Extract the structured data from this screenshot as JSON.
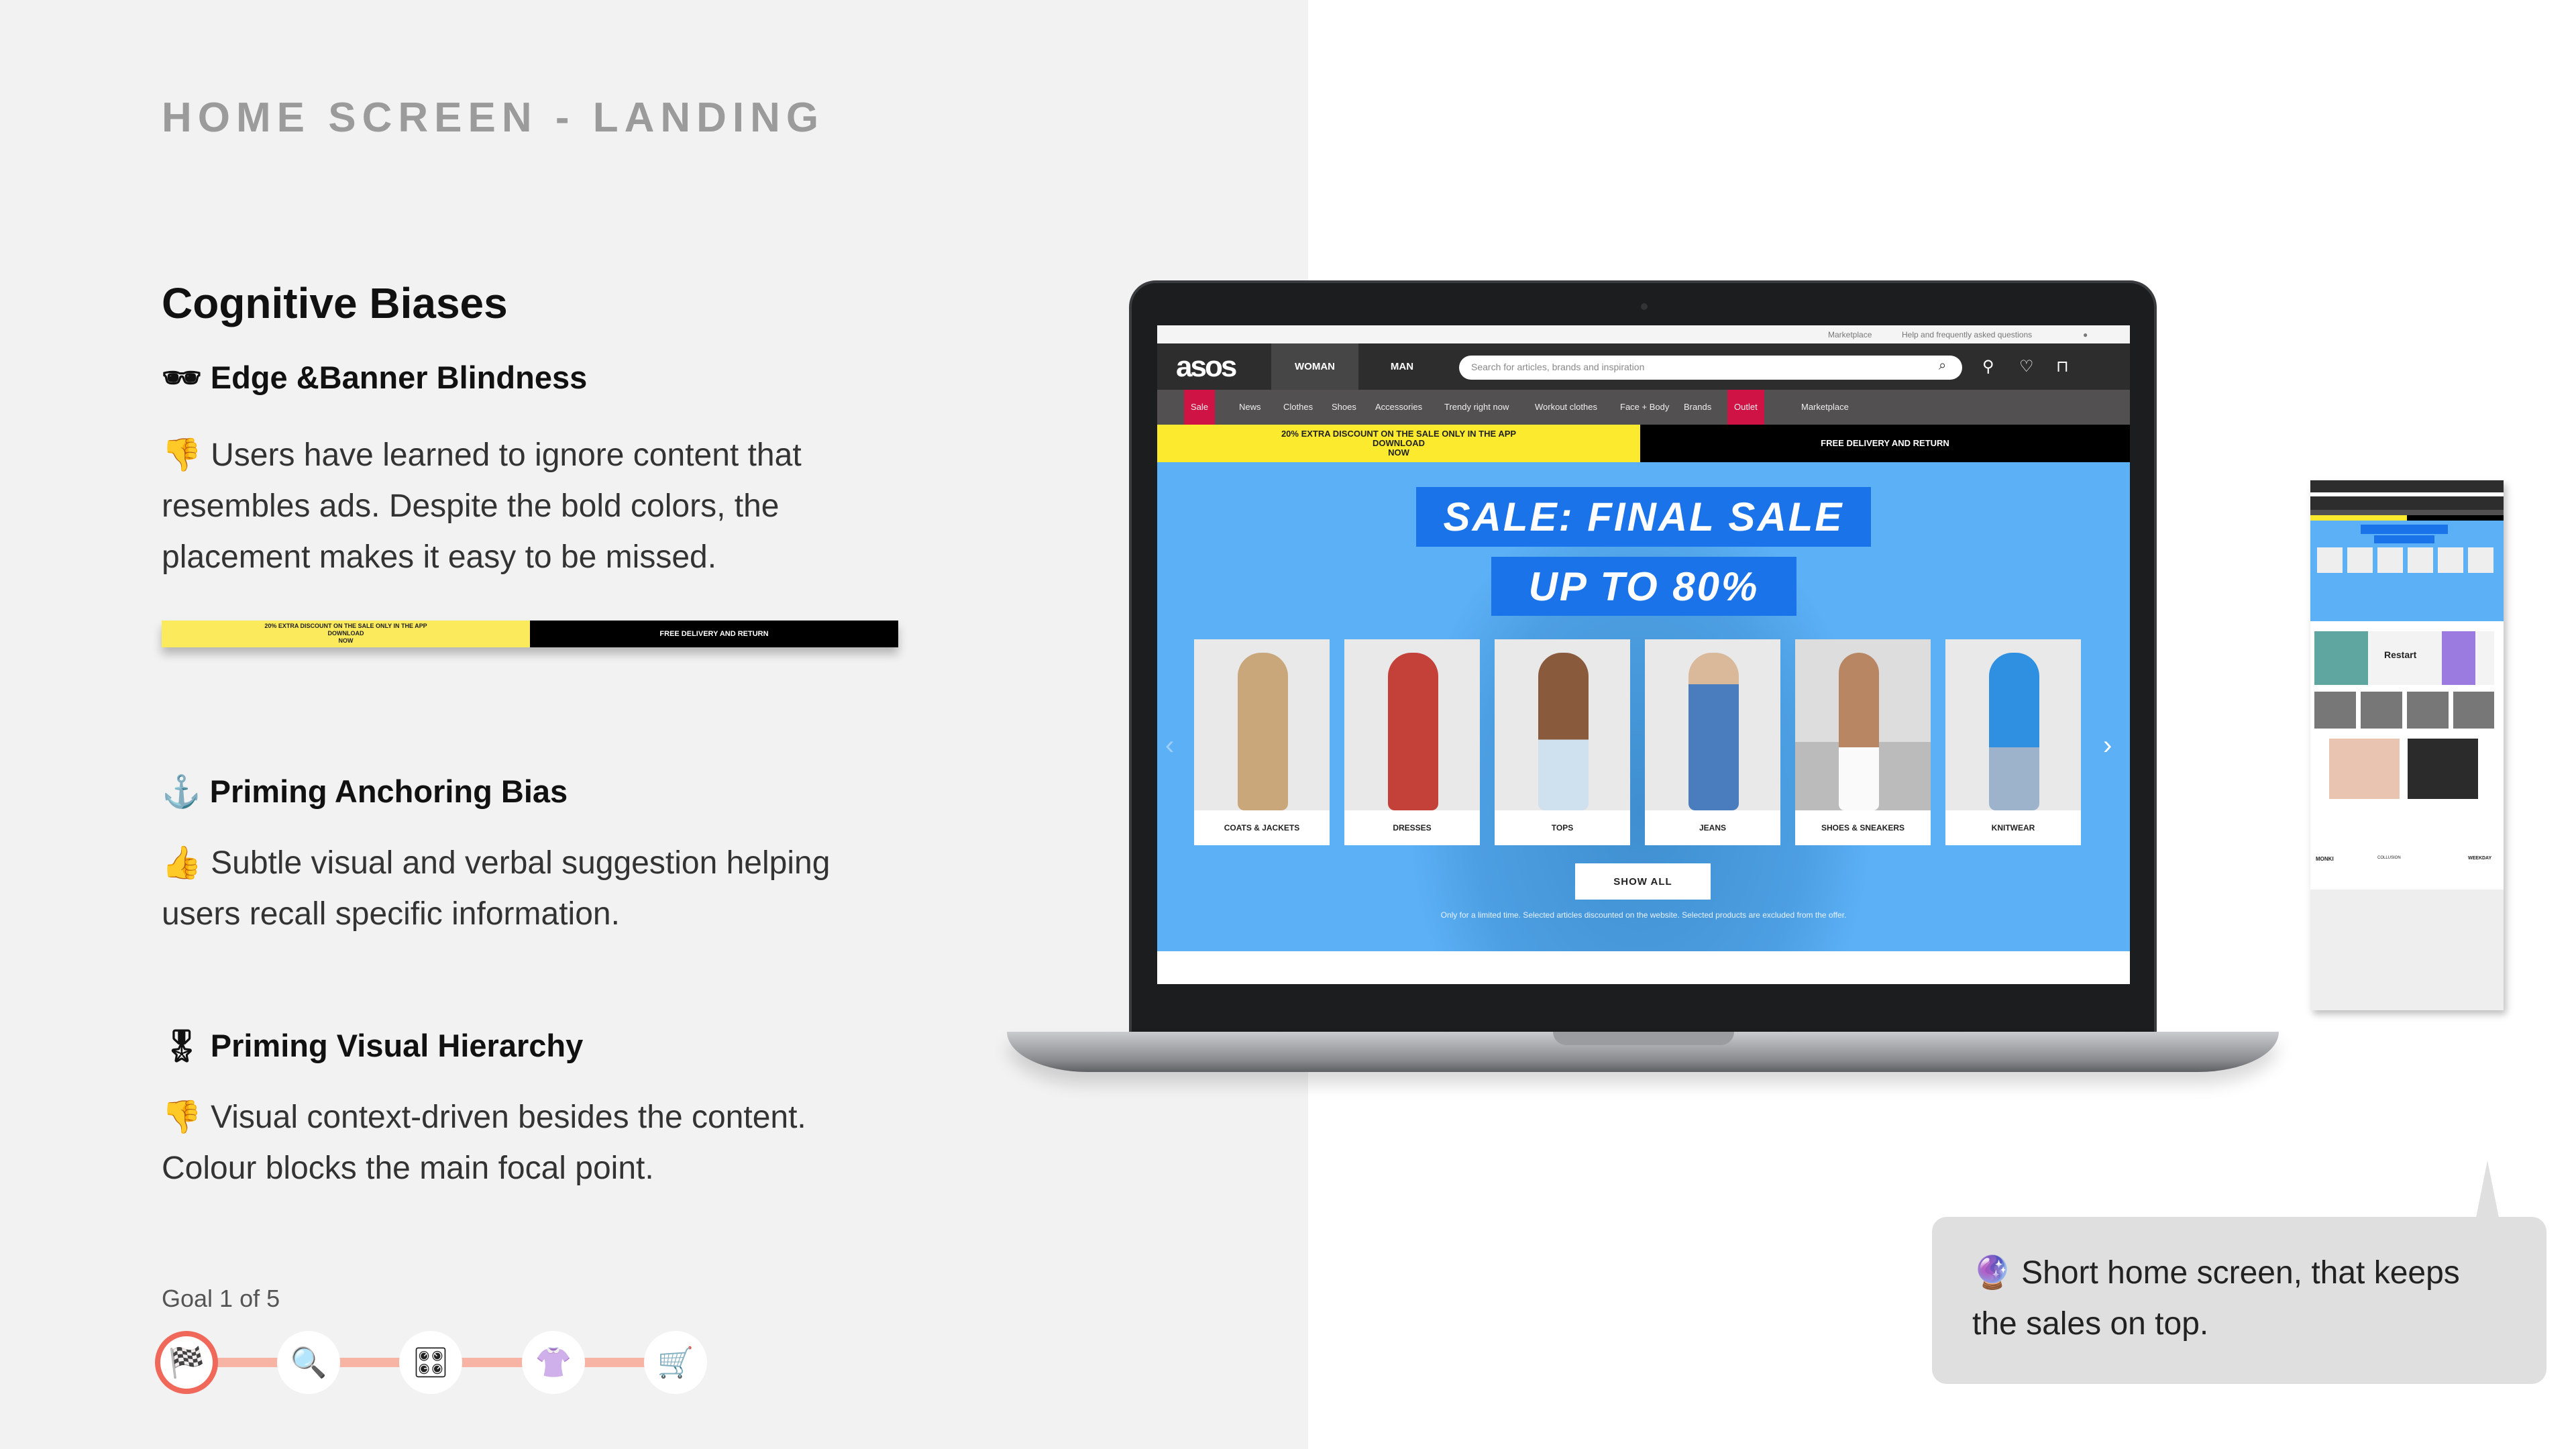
{
  "page_title": "HOME SCREEN - LANDING",
  "section_title": "Cognitive Biases",
  "biases": [
    {
      "icon": "🕶",
      "title": "Edge &Banner Blindness",
      "emoji": "👎",
      "text": "Users have learned to ignore content that resembles ads. Despite the bold colors, the placement makes it easy to be missed."
    },
    {
      "icon": "⚓",
      "title": "Priming Anchoring Bias",
      "emoji": "👍",
      "text": "Subtle visual and verbal suggestion helping users recall specific information."
    },
    {
      "icon": "🎖",
      "title": "Priming Visual Hierarchy",
      "emoji": "👎",
      "text": "Visual context-driven besides the content. Colour blocks the main focal point."
    }
  ],
  "banner": {
    "yellow_line1": "20% EXTRA DISCOUNT ON THE SALE ONLY IN THE APP",
    "yellow_line2": "DOWNLOAD",
    "yellow_line3": "NOW",
    "black": "FREE DELIVERY AND RETURN"
  },
  "goal": {
    "label": "Goal 1 of 5",
    "current": 1,
    "total": 5,
    "steps": [
      {
        "icon": "🏁",
        "name": "checkered-flag"
      },
      {
        "icon": "🔍",
        "name": "magnifier"
      },
      {
        "icon": "🎛",
        "name": "control-knobs"
      },
      {
        "icon": "👚",
        "name": "blouse"
      },
      {
        "icon": "🛒",
        "name": "shopping-cart"
      }
    ]
  },
  "site": {
    "util": {
      "marketplace": "Marketplace",
      "help": "Help and frequently asked questions"
    },
    "logo": "asos",
    "gender_tabs": [
      "WOMAN",
      "MAN"
    ],
    "search_placeholder": "Search for articles, brands and inspiration",
    "nav": [
      "Sale",
      "News",
      "Clothes",
      "Shoes",
      "Accessories",
      "Trendy right now",
      "Workout clothes",
      "Face + Body",
      "Brands",
      "Outlet",
      "Marketplace"
    ],
    "hero_title": "SALE: FINAL SALE",
    "hero_sub": "UP TO 80%",
    "categories": [
      "COATS & JACKETS",
      "DRESSES",
      "TOPS",
      "JEANS",
      "SHOES & SNEAKERS",
      "KNITWEAR"
    ],
    "show_all": "SHOW ALL",
    "disclaimer": "Only for a limited time. Selected articles discounted on the website. Selected products are excluded from the offer.",
    "colors": {
      "sale_red": "#d01345",
      "hero_blue": "#5cb0f5",
      "banner_yellow": "#fbea5c"
    }
  },
  "mobile": {
    "restart": "Restart",
    "brands": [
      "MONKI",
      "COLLUSION",
      "WEEKDAY"
    ]
  },
  "bubble": {
    "emoji": "🔮",
    "text": "Short home screen, that keeps the sales on top."
  }
}
